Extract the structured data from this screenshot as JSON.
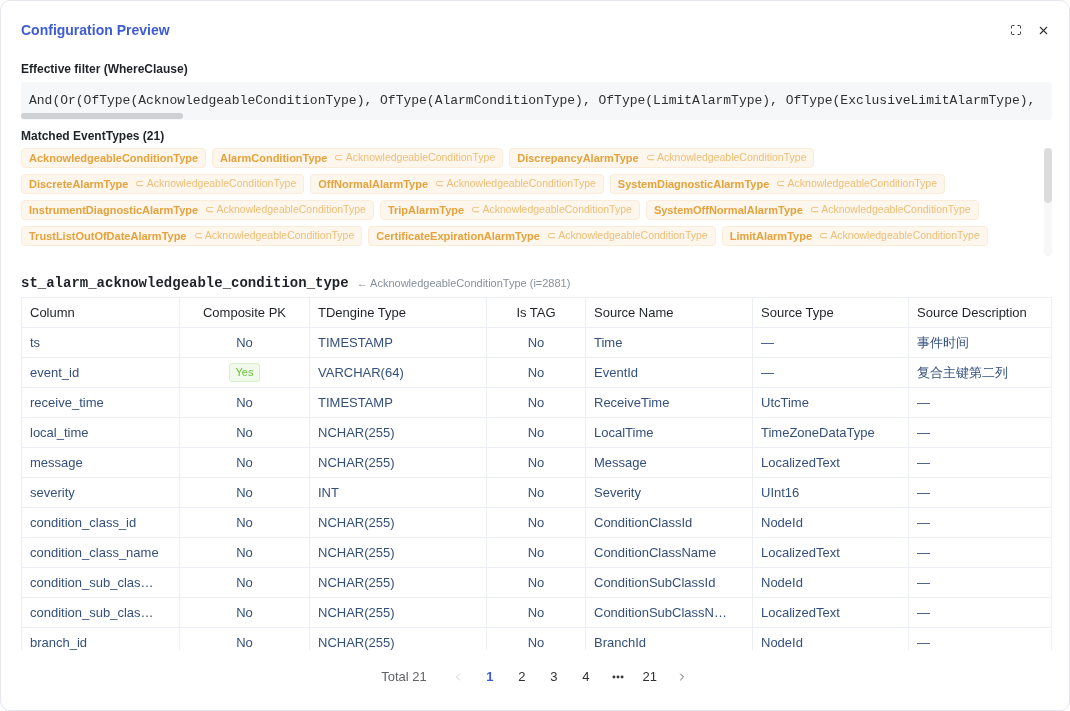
{
  "dialog": {
    "title": "Configuration Preview"
  },
  "filter": {
    "label": "Effective filter (WhereClause)",
    "expression": "And(Or(OfType(AcknowledgeableConditionType), OfType(AlarmConditionType), OfType(LimitAlarmType), OfType(ExclusiveLimitAlarmType),"
  },
  "event_types": {
    "label": "Matched EventTypes (21)",
    "tags": [
      {
        "name": "AcknowledgeableConditionType"
      },
      {
        "name": "AlarmConditionType",
        "parent": "⊂ AcknowledgeableConditionType"
      },
      {
        "name": "DiscrepancyAlarmType",
        "parent": "⊂ AcknowledgeableConditionType"
      },
      {
        "name": "DiscreteAlarmType",
        "parent": "⊂ AcknowledgeableConditionType"
      },
      {
        "name": "OffNormalAlarmType",
        "parent": "⊂ AcknowledgeableConditionType"
      },
      {
        "name": "SystemDiagnosticAlarmType",
        "parent": "⊂ AcknowledgeableConditionType"
      },
      {
        "name": "InstrumentDiagnosticAlarmType",
        "parent": "⊂ AcknowledgeableConditionType"
      },
      {
        "name": "TripAlarmType",
        "parent": "⊂ AcknowledgeableConditionType"
      },
      {
        "name": "SystemOffNormalAlarmType",
        "parent": "⊂ AcknowledgeableConditionType"
      },
      {
        "name": "TrustListOutOfDateAlarmType",
        "parent": "⊂ AcknowledgeableConditionType"
      },
      {
        "name": "CertificateExpirationAlarmType",
        "parent": "⊂ AcknowledgeableConditionType"
      },
      {
        "name": "LimitAlarmType",
        "parent": "⊂ AcknowledgeableConditionType"
      }
    ]
  },
  "table_heading": {
    "name": "st_alarm_acknowledgeable_condition_type",
    "source": "← AcknowledgeableConditionType (i=2881)"
  },
  "table": {
    "columns": [
      "Column",
      "Composite PK",
      "TDengine Type",
      "Is TAG",
      "Source Name",
      "Source Type",
      "Source Description"
    ],
    "rows": [
      {
        "column": "ts",
        "composite_pk": {
          "kind": "plain",
          "text": "No"
        },
        "tdengine_type": "TIMESTAMP",
        "is_tag": "No",
        "source_name": "Time",
        "source_type": "—",
        "source_description": "事件时间"
      },
      {
        "column": "event_id",
        "composite_pk": {
          "kind": "badge",
          "text": "Yes"
        },
        "tdengine_type": "VARCHAR(64)",
        "is_tag": "No",
        "source_name": "EventId",
        "source_type": "—",
        "source_description": "复合主键第二列"
      },
      {
        "column": "receive_time",
        "composite_pk": {
          "kind": "plain",
          "text": "No"
        },
        "tdengine_type": "TIMESTAMP",
        "is_tag": "No",
        "source_name": "ReceiveTime",
        "source_type": "UtcTime",
        "source_description": "—"
      },
      {
        "column": "local_time",
        "composite_pk": {
          "kind": "plain",
          "text": "No"
        },
        "tdengine_type": "NCHAR(255)",
        "is_tag": "No",
        "source_name": "LocalTime",
        "source_type": "TimeZoneDataType",
        "source_description": "—"
      },
      {
        "column": "message",
        "composite_pk": {
          "kind": "plain",
          "text": "No"
        },
        "tdengine_type": "NCHAR(255)",
        "is_tag": "No",
        "source_name": "Message",
        "source_type": "LocalizedText",
        "source_description": "—"
      },
      {
        "column": "severity",
        "composite_pk": {
          "kind": "plain",
          "text": "No"
        },
        "tdengine_type": "INT",
        "is_tag": "No",
        "source_name": "Severity",
        "source_type": "UInt16",
        "source_description": "—"
      },
      {
        "column": "condition_class_id",
        "composite_pk": {
          "kind": "plain",
          "text": "No"
        },
        "tdengine_type": "NCHAR(255)",
        "is_tag": "No",
        "source_name": "ConditionClassId",
        "source_type": "NodeId",
        "source_description": "—"
      },
      {
        "column": "condition_class_name",
        "composite_pk": {
          "kind": "plain",
          "text": "No"
        },
        "tdengine_type": "NCHAR(255)",
        "is_tag": "No",
        "source_name": "ConditionClassName",
        "source_type": "LocalizedText",
        "source_description": "—"
      },
      {
        "column": "condition_sub_clas…",
        "composite_pk": {
          "kind": "plain",
          "text": "No"
        },
        "tdengine_type": "NCHAR(255)",
        "is_tag": "No",
        "source_name": "ConditionSubClassId",
        "source_type": "NodeId",
        "source_description": "—"
      },
      {
        "column": "condition_sub_clas…",
        "composite_pk": {
          "kind": "plain",
          "text": "No"
        },
        "tdengine_type": "NCHAR(255)",
        "is_tag": "No",
        "source_name": "ConditionSubClassN…",
        "source_type": "LocalizedText",
        "source_description": "—"
      },
      {
        "column": "branch_id",
        "composite_pk": {
          "kind": "plain",
          "text": "No"
        },
        "tdengine_type": "NCHAR(255)",
        "is_tag": "No",
        "source_name": "BranchId",
        "source_type": "NodeId",
        "source_description": "—"
      }
    ]
  },
  "pagination": {
    "total": "Total 21",
    "prev": {
      "disabled": true
    },
    "pages": [
      {
        "kind": "page",
        "label": "1",
        "selected": true
      },
      {
        "kind": "page",
        "label": "2",
        "selected": false
      },
      {
        "kind": "page",
        "label": "3",
        "selected": false
      },
      {
        "kind": "page",
        "label": "4",
        "selected": false
      },
      {
        "kind": "ellipsis",
        "selected": false
      },
      {
        "kind": "page",
        "label": "21",
        "selected": false
      }
    ],
    "next": {
      "disabled": false
    }
  }
}
